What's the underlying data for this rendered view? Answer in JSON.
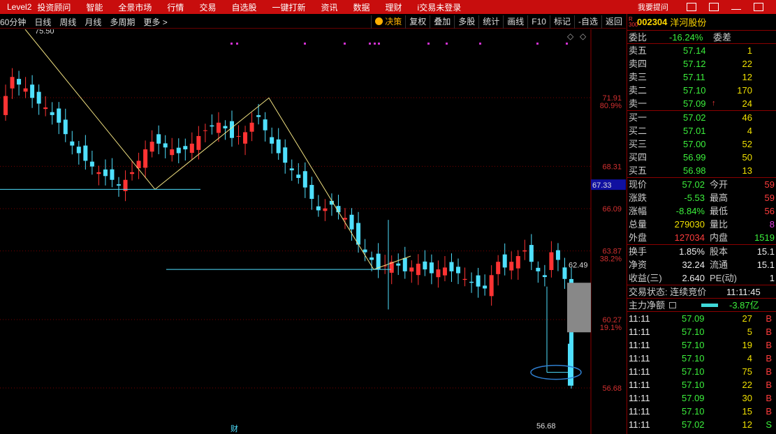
{
  "topbar": {
    "logo": "Level2",
    "menu": [
      "投资顾问",
      "智能",
      "全景市场",
      "行情",
      "交易",
      "自选股",
      "一键打新",
      "资讯",
      "数据",
      "理财",
      "i交易未登录"
    ],
    "ask": "我要提问"
  },
  "toolbar": {
    "periods": [
      "60分钟",
      "日线",
      "周线",
      "月线",
      "多周期",
      "更多 >"
    ],
    "tools": [
      "决策",
      "复权",
      "叠加",
      "多股",
      "统计",
      "画线",
      "F10",
      "标记",
      "-自选",
      "返回"
    ]
  },
  "chart_data": {
    "type": "candlestick",
    "y_axis_labels": [
      {
        "price": "71.91",
        "pct": "80.9%"
      },
      {
        "price": "68.31",
        "pct": ""
      },
      {
        "price": "66.09",
        "pct": ""
      },
      {
        "price": "63.87",
        "pct": "38.2%"
      },
      {
        "price": "60.27",
        "pct": "19.1%"
      },
      {
        "price": "56.68",
        "pct": ""
      }
    ],
    "current_price_tag": "67.33",
    "annotations": {
      "high": "75.50",
      "low": "56.68",
      "last": "62.49",
      "marker": "财"
    }
  },
  "quote": {
    "code": "002304",
    "name": "洋河股份",
    "index_tag": "R\n300",
    "weibi": {
      "label": "委比",
      "value": "-16.24%",
      "label2": "委差"
    },
    "sell": [
      {
        "label": "卖五",
        "price": "57.14",
        "vol": "1"
      },
      {
        "label": "卖四",
        "price": "57.12",
        "vol": "22"
      },
      {
        "label": "卖三",
        "price": "57.11",
        "vol": "12"
      },
      {
        "label": "卖二",
        "price": "57.10",
        "vol": "170"
      },
      {
        "label": "卖一",
        "price": "57.09",
        "vol": "24"
      }
    ],
    "buy": [
      {
        "label": "买一",
        "price": "57.02",
        "vol": "46"
      },
      {
        "label": "买二",
        "price": "57.01",
        "vol": "4"
      },
      {
        "label": "买三",
        "price": "57.00",
        "vol": "52"
      },
      {
        "label": "买四",
        "price": "56.99",
        "vol": "50"
      },
      {
        "label": "买五",
        "price": "56.98",
        "vol": "13"
      }
    ],
    "stats": [
      {
        "l1": "现价",
        "v1": "57.02",
        "l2": "今开",
        "v2": "59"
      },
      {
        "l1": "涨跌",
        "v1": "-5.53",
        "l2": "最高",
        "v2": "59"
      },
      {
        "l1": "涨幅",
        "v1": "-8.84%",
        "l2": "最低",
        "v2": "56"
      },
      {
        "l1": "总量",
        "v1": "279030",
        "l2": "量比",
        "v2": "8"
      },
      {
        "l1": "外盘",
        "v1": "127034",
        "l2": "内盘",
        "v2": "1519"
      }
    ],
    "stats2": [
      {
        "l1": "换手",
        "v1": "1.85%",
        "l2": "股本",
        "v2": "15.1"
      },
      {
        "l1": "净资",
        "v1": "32.24",
        "l2": "流通",
        "v2": "15.1"
      },
      {
        "l1": "收益(三)",
        "v1": "2.640",
        "l2": "PE(动)",
        "v2": "1"
      }
    ],
    "status": {
      "label": "交易状态: 连续竞价",
      "time": "11:11:45"
    },
    "zhuli": {
      "label": "主力净额",
      "value": "-3.87亿"
    },
    "ticks": [
      {
        "t": "11:11",
        "p": "57.09",
        "v": "27",
        "s": "B"
      },
      {
        "t": "11:11",
        "p": "57.10",
        "v": "5",
        "s": "B"
      },
      {
        "t": "11:11",
        "p": "57.10",
        "v": "19",
        "s": "B"
      },
      {
        "t": "11:11",
        "p": "57.10",
        "v": "4",
        "s": "B"
      },
      {
        "t": "11:11",
        "p": "57.10",
        "v": "75",
        "s": "B"
      },
      {
        "t": "11:11",
        "p": "57.10",
        "v": "22",
        "s": "B"
      },
      {
        "t": "11:11",
        "p": "57.09",
        "v": "30",
        "s": "B"
      },
      {
        "t": "11:11",
        "p": "57.10",
        "v": "15",
        "s": "B"
      },
      {
        "t": "11:11",
        "p": "57.02",
        "v": "12",
        "s": "S"
      }
    ]
  }
}
